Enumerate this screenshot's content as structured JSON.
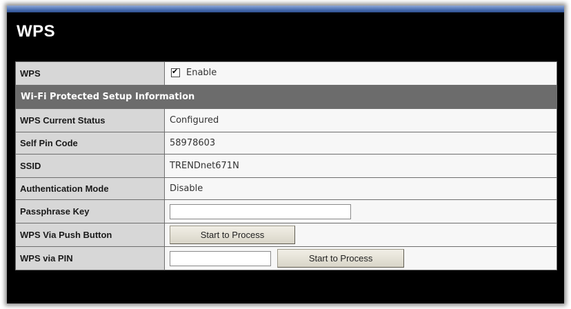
{
  "page": {
    "title": "WPS"
  },
  "wps": {
    "label": "WPS",
    "enable_label": "Enable",
    "enable_checked": true
  },
  "section": {
    "title": "Wi-Fi Protected Setup Information"
  },
  "rows": {
    "current_status": {
      "label": "WPS Current Status",
      "value": "Configured"
    },
    "self_pin": {
      "label": "Self Pin Code",
      "value": "58978603"
    },
    "ssid": {
      "label": "SSID",
      "value": "TRENDnet671N"
    },
    "auth_mode": {
      "label": "Authentication Mode",
      "value": "Disable"
    },
    "passphrase": {
      "label": "Passphrase Key",
      "value": ""
    },
    "push_button": {
      "label": "WPS Via Push Button",
      "button_label": "Start to Process"
    },
    "via_pin": {
      "label": "WPS via PIN",
      "value": "",
      "button_label": "Start to Process"
    }
  },
  "icons": {
    "checkbox": "checkmark-icon"
  }
}
